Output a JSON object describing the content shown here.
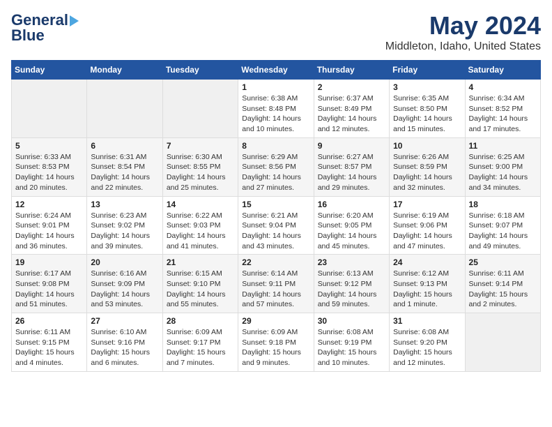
{
  "header": {
    "logo_general": "General",
    "logo_blue": "Blue",
    "title": "May 2024",
    "subtitle": "Middleton, Idaho, United States"
  },
  "weekdays": [
    "Sunday",
    "Monday",
    "Tuesday",
    "Wednesday",
    "Thursday",
    "Friday",
    "Saturday"
  ],
  "weeks": [
    [
      {
        "day": "",
        "info": ""
      },
      {
        "day": "",
        "info": ""
      },
      {
        "day": "",
        "info": ""
      },
      {
        "day": "1",
        "info": "Sunrise: 6:38 AM\nSunset: 8:48 PM\nDaylight: 14 hours\nand 10 minutes."
      },
      {
        "day": "2",
        "info": "Sunrise: 6:37 AM\nSunset: 8:49 PM\nDaylight: 14 hours\nand 12 minutes."
      },
      {
        "day": "3",
        "info": "Sunrise: 6:35 AM\nSunset: 8:50 PM\nDaylight: 14 hours\nand 15 minutes."
      },
      {
        "day": "4",
        "info": "Sunrise: 6:34 AM\nSunset: 8:52 PM\nDaylight: 14 hours\nand 17 minutes."
      }
    ],
    [
      {
        "day": "5",
        "info": "Sunrise: 6:33 AM\nSunset: 8:53 PM\nDaylight: 14 hours\nand 20 minutes."
      },
      {
        "day": "6",
        "info": "Sunrise: 6:31 AM\nSunset: 8:54 PM\nDaylight: 14 hours\nand 22 minutes."
      },
      {
        "day": "7",
        "info": "Sunrise: 6:30 AM\nSunset: 8:55 PM\nDaylight: 14 hours\nand 25 minutes."
      },
      {
        "day": "8",
        "info": "Sunrise: 6:29 AM\nSunset: 8:56 PM\nDaylight: 14 hours\nand 27 minutes."
      },
      {
        "day": "9",
        "info": "Sunrise: 6:27 AM\nSunset: 8:57 PM\nDaylight: 14 hours\nand 29 minutes."
      },
      {
        "day": "10",
        "info": "Sunrise: 6:26 AM\nSunset: 8:59 PM\nDaylight: 14 hours\nand 32 minutes."
      },
      {
        "day": "11",
        "info": "Sunrise: 6:25 AM\nSunset: 9:00 PM\nDaylight: 14 hours\nand 34 minutes."
      }
    ],
    [
      {
        "day": "12",
        "info": "Sunrise: 6:24 AM\nSunset: 9:01 PM\nDaylight: 14 hours\nand 36 minutes."
      },
      {
        "day": "13",
        "info": "Sunrise: 6:23 AM\nSunset: 9:02 PM\nDaylight: 14 hours\nand 39 minutes."
      },
      {
        "day": "14",
        "info": "Sunrise: 6:22 AM\nSunset: 9:03 PM\nDaylight: 14 hours\nand 41 minutes."
      },
      {
        "day": "15",
        "info": "Sunrise: 6:21 AM\nSunset: 9:04 PM\nDaylight: 14 hours\nand 43 minutes."
      },
      {
        "day": "16",
        "info": "Sunrise: 6:20 AM\nSunset: 9:05 PM\nDaylight: 14 hours\nand 45 minutes."
      },
      {
        "day": "17",
        "info": "Sunrise: 6:19 AM\nSunset: 9:06 PM\nDaylight: 14 hours\nand 47 minutes."
      },
      {
        "day": "18",
        "info": "Sunrise: 6:18 AM\nSunset: 9:07 PM\nDaylight: 14 hours\nand 49 minutes."
      }
    ],
    [
      {
        "day": "19",
        "info": "Sunrise: 6:17 AM\nSunset: 9:08 PM\nDaylight: 14 hours\nand 51 minutes."
      },
      {
        "day": "20",
        "info": "Sunrise: 6:16 AM\nSunset: 9:09 PM\nDaylight: 14 hours\nand 53 minutes."
      },
      {
        "day": "21",
        "info": "Sunrise: 6:15 AM\nSunset: 9:10 PM\nDaylight: 14 hours\nand 55 minutes."
      },
      {
        "day": "22",
        "info": "Sunrise: 6:14 AM\nSunset: 9:11 PM\nDaylight: 14 hours\nand 57 minutes."
      },
      {
        "day": "23",
        "info": "Sunrise: 6:13 AM\nSunset: 9:12 PM\nDaylight: 14 hours\nand 59 minutes."
      },
      {
        "day": "24",
        "info": "Sunrise: 6:12 AM\nSunset: 9:13 PM\nDaylight: 15 hours\nand 1 minute."
      },
      {
        "day": "25",
        "info": "Sunrise: 6:11 AM\nSunset: 9:14 PM\nDaylight: 15 hours\nand 2 minutes."
      }
    ],
    [
      {
        "day": "26",
        "info": "Sunrise: 6:11 AM\nSunset: 9:15 PM\nDaylight: 15 hours\nand 4 minutes."
      },
      {
        "day": "27",
        "info": "Sunrise: 6:10 AM\nSunset: 9:16 PM\nDaylight: 15 hours\nand 6 minutes."
      },
      {
        "day": "28",
        "info": "Sunrise: 6:09 AM\nSunset: 9:17 PM\nDaylight: 15 hours\nand 7 minutes."
      },
      {
        "day": "29",
        "info": "Sunrise: 6:09 AM\nSunset: 9:18 PM\nDaylight: 15 hours\nand 9 minutes."
      },
      {
        "day": "30",
        "info": "Sunrise: 6:08 AM\nSunset: 9:19 PM\nDaylight: 15 hours\nand 10 minutes."
      },
      {
        "day": "31",
        "info": "Sunrise: 6:08 AM\nSunset: 9:20 PM\nDaylight: 15 hours\nand 12 minutes."
      },
      {
        "day": "",
        "info": ""
      }
    ]
  ]
}
